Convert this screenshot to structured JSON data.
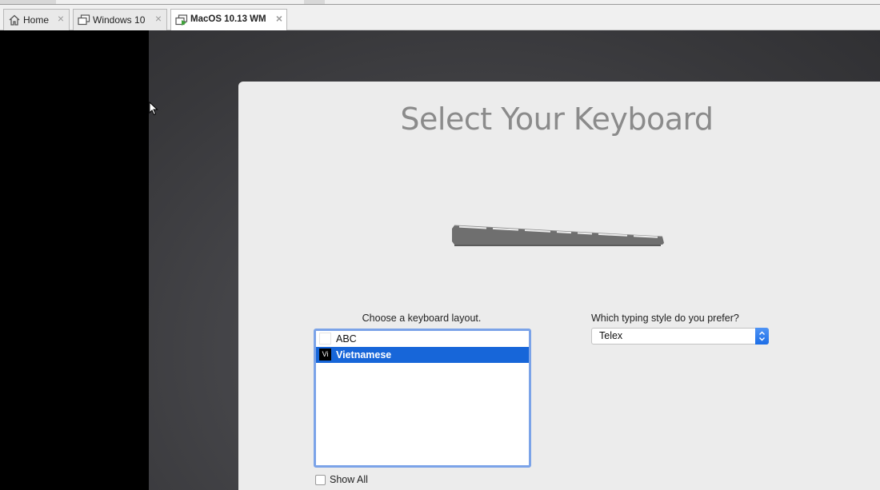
{
  "tabs": [
    {
      "label": "Home",
      "icon": "home-icon",
      "active": false
    },
    {
      "label": "Windows 10",
      "icon": "vm-icon",
      "active": false
    },
    {
      "label": "MacOS 10.13 WM",
      "icon": "vm-running-icon",
      "active": true
    }
  ],
  "setup": {
    "title": "Select Your Keyboard",
    "layout_prompt": "Choose a keyboard layout.",
    "layouts": [
      {
        "flag": "",
        "label": "ABC",
        "selected": false
      },
      {
        "flag": "Vi",
        "label": "Vietnamese",
        "selected": true
      }
    ],
    "show_all_label": "Show All",
    "show_all_checked": false,
    "style_prompt": "Which typing style do you prefer?",
    "style_value": "Telex"
  },
  "colors": {
    "selection": "#1766d9",
    "focus_ring": "#7ba3e8",
    "title_gray": "#8b8b8b",
    "panel_bg": "#ececec"
  }
}
